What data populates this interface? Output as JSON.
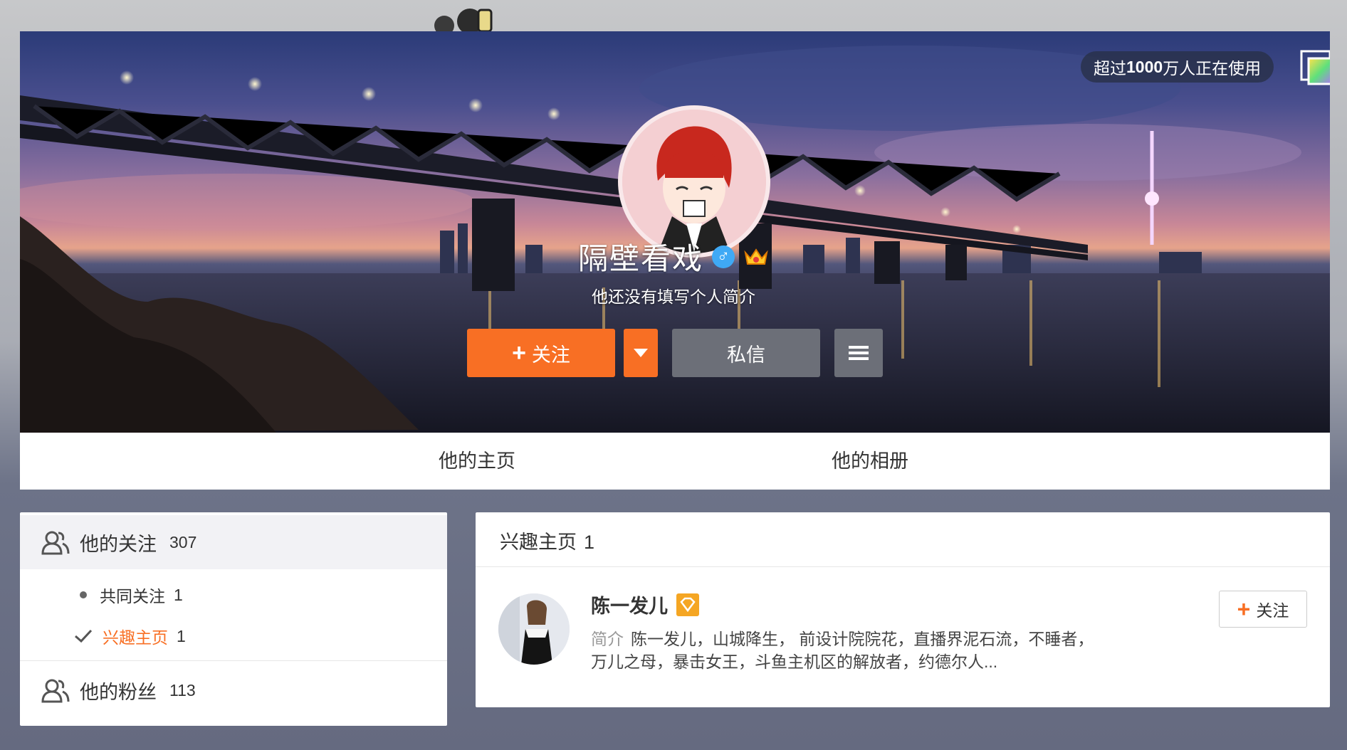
{
  "cover": {
    "users_prefix": "超过",
    "users_number": "1000",
    "users_suffix": "万人正在使用"
  },
  "profile": {
    "nickname": "隔壁看戏",
    "gender_symbol": "♂",
    "bio": "他还没有填写个人简介"
  },
  "actions": {
    "follow_plus": "+",
    "follow_label": "关注",
    "message_label": "私信"
  },
  "tabs": [
    {
      "label": "他的主页"
    },
    {
      "label": "他的相册"
    }
  ],
  "left_panel": {
    "following_label": "他的关注",
    "following_count": "307",
    "mutual_label": "共同关注",
    "mutual_count": "1",
    "interest_label": "兴趣主页",
    "interest_count": "1",
    "fans_label": "他的粉丝",
    "fans_count": "113"
  },
  "right_panel": {
    "title": "兴趣主页",
    "count": "1",
    "item": {
      "name": "陈一发儿",
      "desc_label": "简介",
      "desc_text": "陈一发儿，山城降生， 前设计院院花，直播界泥石流，不睡者，万儿之母，暴击女王，斗鱼主机区的解放者，约德尔人...",
      "follow_plus": "+",
      "follow_label": "关注"
    }
  },
  "colors": {
    "accent": "#f86f24",
    "secondary_button": "#6c6f78",
    "gender_badge": "#3fa9f5"
  }
}
